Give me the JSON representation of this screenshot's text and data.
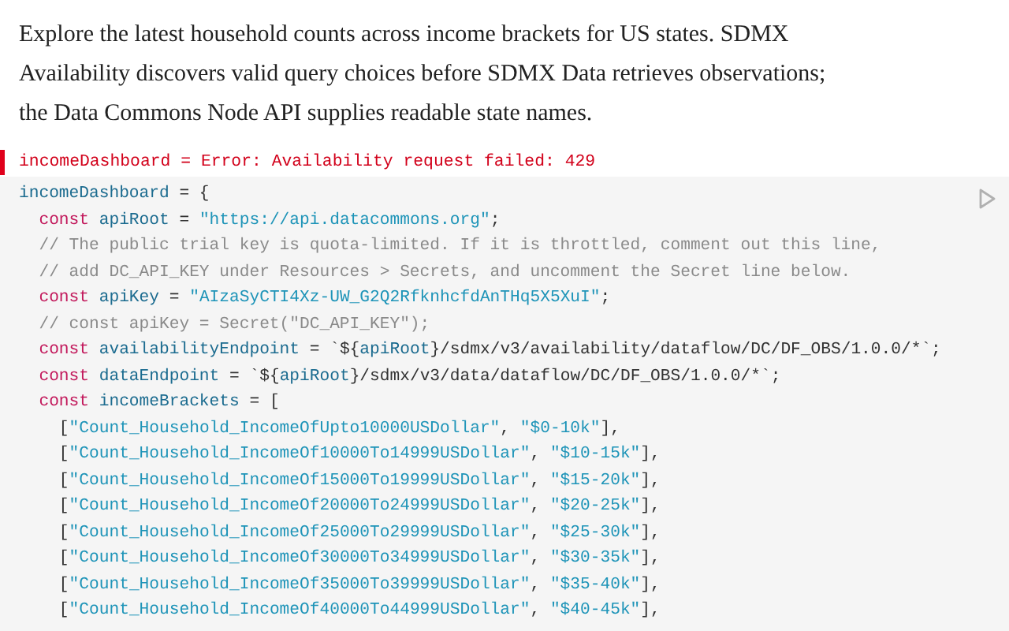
{
  "intro": "Explore the latest household counts across income brackets for US states. SDMX Availability discovers valid query choices before SDMX Data retrieves observations; the Data Commons Node API supplies readable state names.",
  "error": "incomeDashboard = Error: Availability request failed: 429",
  "code_lines": [
    [
      {
        "kind": "variable",
        "text": "incomeDashboard"
      },
      {
        "kind": "plain",
        "text": " = {"
      }
    ],
    [
      {
        "kind": "keyword",
        "text": "  const "
      },
      {
        "kind": "variable",
        "text": "apiRoot"
      },
      {
        "kind": "plain",
        "text": " = "
      },
      {
        "kind": "string",
        "text": "\"https://api.datacommons.org\""
      },
      {
        "kind": "plain",
        "text": ";"
      }
    ],
    [
      {
        "kind": "comment",
        "text": "  // The public trial key is quota-limited. If it is throttled, comment out this line,"
      }
    ],
    [
      {
        "kind": "comment",
        "text": "  // add DC_API_KEY under Resources > Secrets, and uncomment the Secret line below."
      }
    ],
    [
      {
        "kind": "keyword",
        "text": "  const "
      },
      {
        "kind": "variable",
        "text": "apiKey"
      },
      {
        "kind": "plain",
        "text": " = "
      },
      {
        "kind": "string",
        "text": "\"AIzaSyCTI4Xz-UW_G2Q2RfknhcfdAnTHq5X5XuI\""
      },
      {
        "kind": "plain",
        "text": ";"
      }
    ],
    [
      {
        "kind": "comment",
        "text": "  // const apiKey = Secret(\"DC_API_KEY\");"
      }
    ],
    [
      {
        "kind": "keyword",
        "text": "  const "
      },
      {
        "kind": "variable",
        "text": "availabilityEndpoint"
      },
      {
        "kind": "plain",
        "text": " = `${"
      },
      {
        "kind": "variable",
        "text": "apiRoot"
      },
      {
        "kind": "plain",
        "text": "}/sdmx/v3/availability/dataflow/DC/DF_OBS/1.0.0/*`;"
      }
    ],
    [
      {
        "kind": "keyword",
        "text": "  const "
      },
      {
        "kind": "variable",
        "text": "dataEndpoint"
      },
      {
        "kind": "plain",
        "text": " = `${"
      },
      {
        "kind": "variable",
        "text": "apiRoot"
      },
      {
        "kind": "plain",
        "text": "}/sdmx/v3/data/dataflow/DC/DF_OBS/1.0.0/*`;"
      }
    ],
    [
      {
        "kind": "keyword",
        "text": "  const "
      },
      {
        "kind": "variable",
        "text": "incomeBrackets"
      },
      {
        "kind": "plain",
        "text": " = ["
      }
    ],
    [
      {
        "kind": "plain",
        "text": "    ["
      },
      {
        "kind": "string",
        "text": "\"Count_Household_IncomeOfUpto10000USDollar\""
      },
      {
        "kind": "plain",
        "text": ", "
      },
      {
        "kind": "string",
        "text": "\"$0-10k\""
      },
      {
        "kind": "plain",
        "text": "],"
      }
    ],
    [
      {
        "kind": "plain",
        "text": "    ["
      },
      {
        "kind": "string",
        "text": "\"Count_Household_IncomeOf10000To14999USDollar\""
      },
      {
        "kind": "plain",
        "text": ", "
      },
      {
        "kind": "string",
        "text": "\"$10-15k\""
      },
      {
        "kind": "plain",
        "text": "],"
      }
    ],
    [
      {
        "kind": "plain",
        "text": "    ["
      },
      {
        "kind": "string",
        "text": "\"Count_Household_IncomeOf15000To19999USDollar\""
      },
      {
        "kind": "plain",
        "text": ", "
      },
      {
        "kind": "string",
        "text": "\"$15-20k\""
      },
      {
        "kind": "plain",
        "text": "],"
      }
    ],
    [
      {
        "kind": "plain",
        "text": "    ["
      },
      {
        "kind": "string",
        "text": "\"Count_Household_IncomeOf20000To24999USDollar\""
      },
      {
        "kind": "plain",
        "text": ", "
      },
      {
        "kind": "string",
        "text": "\"$20-25k\""
      },
      {
        "kind": "plain",
        "text": "],"
      }
    ],
    [
      {
        "kind": "plain",
        "text": "    ["
      },
      {
        "kind": "string",
        "text": "\"Count_Household_IncomeOf25000To29999USDollar\""
      },
      {
        "kind": "plain",
        "text": ", "
      },
      {
        "kind": "string",
        "text": "\"$25-30k\""
      },
      {
        "kind": "plain",
        "text": "],"
      }
    ],
    [
      {
        "kind": "plain",
        "text": "    ["
      },
      {
        "kind": "string",
        "text": "\"Count_Household_IncomeOf30000To34999USDollar\""
      },
      {
        "kind": "plain",
        "text": ", "
      },
      {
        "kind": "string",
        "text": "\"$30-35k\""
      },
      {
        "kind": "plain",
        "text": "],"
      }
    ],
    [
      {
        "kind": "plain",
        "text": "    ["
      },
      {
        "kind": "string",
        "text": "\"Count_Household_IncomeOf35000To39999USDollar\""
      },
      {
        "kind": "plain",
        "text": ", "
      },
      {
        "kind": "string",
        "text": "\"$35-40k\""
      },
      {
        "kind": "plain",
        "text": "],"
      }
    ],
    [
      {
        "kind": "plain",
        "text": "    ["
      },
      {
        "kind": "string",
        "text": "\"Count_Household_IncomeOf40000To44999USDollar\""
      },
      {
        "kind": "plain",
        "text": ", "
      },
      {
        "kind": "string",
        "text": "\"$40-45k\""
      },
      {
        "kind": "plain",
        "text": "],"
      }
    ]
  ]
}
